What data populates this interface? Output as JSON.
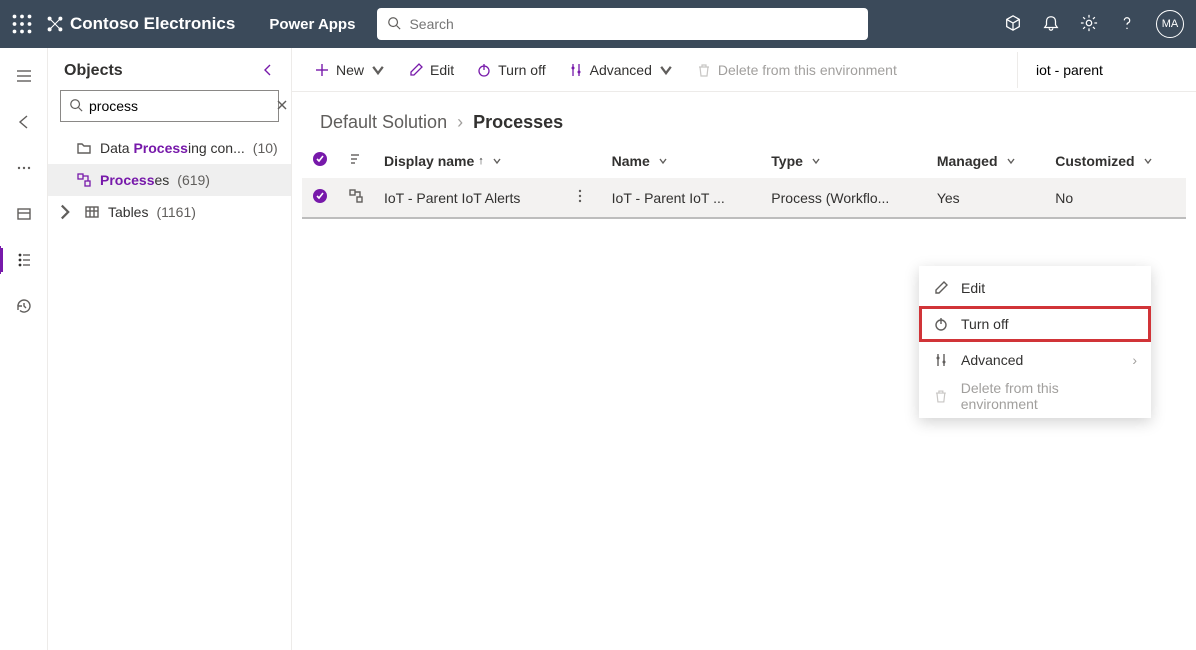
{
  "header": {
    "org": "Contoso Electronics",
    "app": "Power Apps",
    "search_placeholder": "Search",
    "avatar_initials": "MA"
  },
  "objects_panel": {
    "title": "Objects",
    "search_value": "process",
    "items": [
      {
        "icon": "folder",
        "label_pre": "Data ",
        "label_hl": "Process",
        "label_post": "ing con...",
        "count": "(10)",
        "selected": false
      },
      {
        "icon": "process",
        "label_pre": "",
        "label_hl": "Process",
        "label_post": "es",
        "count": "(619)",
        "selected": true
      },
      {
        "icon": "table",
        "label_pre": "Tables",
        "label_hl": "",
        "label_post": "",
        "count": "(1161)",
        "selected": false,
        "caret": true
      }
    ]
  },
  "commandbar": {
    "new": "New",
    "edit": "Edit",
    "turnoff": "Turn off",
    "advanced": "Advanced",
    "delete": "Delete from this environment",
    "search_value": "iot - parent"
  },
  "breadcrumb": {
    "parent": "Default Solution",
    "current": "Processes"
  },
  "table": {
    "columns": {
      "display_name": "Display name",
      "name": "Name",
      "type": "Type",
      "managed": "Managed",
      "customized": "Customized"
    },
    "rows": [
      {
        "display_name": "IoT - Parent IoT Alerts",
        "name": "IoT - Parent IoT ...",
        "type": "Process (Workflo...",
        "managed": "Yes",
        "customized": "No"
      }
    ]
  },
  "context_menu": {
    "edit": "Edit",
    "turnoff": "Turn off",
    "advanced": "Advanced",
    "delete": "Delete from this environment"
  }
}
